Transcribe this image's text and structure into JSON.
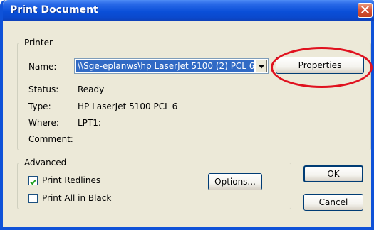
{
  "window": {
    "title": "Print Document"
  },
  "printer": {
    "group_label": "Printer",
    "name_label": "Name:",
    "name_value": "\\\\Sge-eplanws\\hp LaserJet 5100 (2) PCL 6",
    "properties_label": "Properties",
    "status_label": "Status:",
    "status_value": "Ready",
    "type_label": "Type:",
    "type_value": "HP LaserJet 5100 PCL 6",
    "where_label": "Where:",
    "where_value": "LPT1:",
    "comment_label": "Comment:",
    "comment_value": ""
  },
  "advanced": {
    "group_label": "Advanced",
    "print_redlines": {
      "label": "Print Redlines",
      "checked": true
    },
    "print_all_black": {
      "label": "Print All in Black",
      "checked": false
    },
    "options_label": "Options..."
  },
  "buttons": {
    "ok": "OK",
    "cancel": "Cancel"
  },
  "icons": {
    "close": "close-icon",
    "dropdown": "chevron-down-icon",
    "check": "check-icon"
  },
  "colors": {
    "titlebar": "#0a4fd8",
    "selection": "#316ac5",
    "highlight_ring": "#e0121f",
    "dialog_bg": "#ece9d8"
  }
}
